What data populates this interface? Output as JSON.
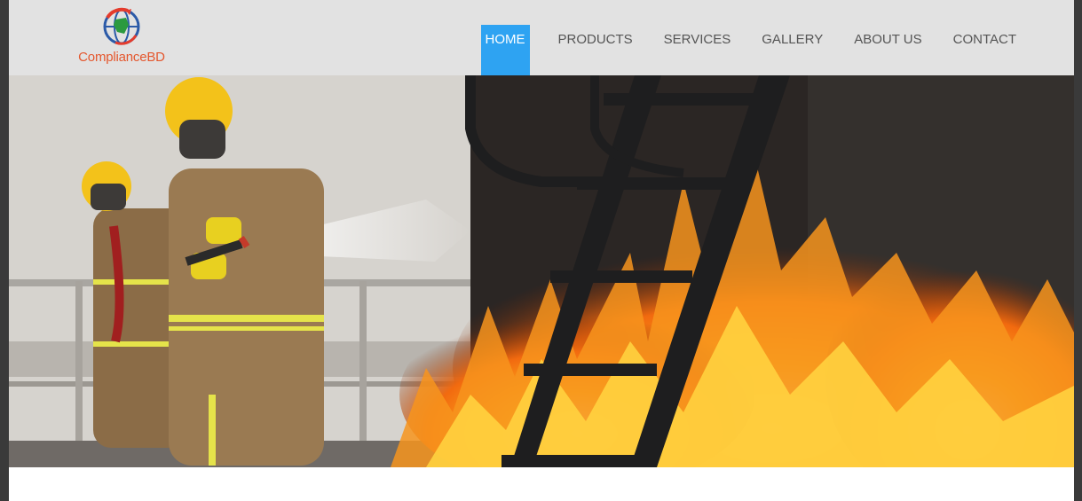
{
  "brand": {
    "name": "ComplianceBD",
    "logo_icon": "globe-icon"
  },
  "nav": {
    "items": [
      {
        "label": "HOME",
        "active": true
      },
      {
        "label": "PRODUCTS",
        "active": false
      },
      {
        "label": "SERVICES",
        "active": false
      },
      {
        "label": "GALLERY",
        "active": false
      },
      {
        "label": "ABOUT US",
        "active": false
      },
      {
        "label": "CONTACT",
        "active": false
      }
    ]
  },
  "colors": {
    "accent": "#2ea3f2",
    "navbar_bg": "#e2e2e2",
    "nav_text": "#555555",
    "logo_text": "#e4572e"
  },
  "hero": {
    "image": "firefighters-spraying-water-at-fire-photo"
  }
}
